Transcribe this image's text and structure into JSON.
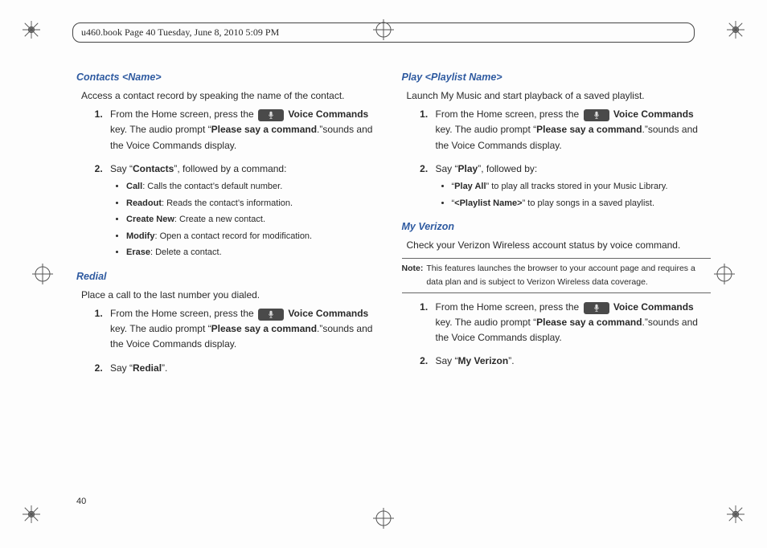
{
  "meta": {
    "header": "u460.book  Page 40  Tuesday, June 8, 2010  5:09 PM",
    "page_number": "40"
  },
  "contacts": {
    "heading": "Contacts <Name>",
    "intro": "Access a contact record by speaking the name of the contact.",
    "step1_pre": "From the Home screen, press the ",
    "step1_post1": " Voice Commands",
    "step1_post2": " key. The audio prompt “",
    "step1_bold": "Please say a command",
    "step1_tail": ".”sounds and the Voice Commands display.",
    "step2_a": "Say “",
    "step2_b": "Contacts",
    "step2_c": "”, followed by a command:",
    "bullets": {
      "b1a": "Call",
      "b1b": ": Calls the contact’s default number.",
      "b2a": "Readout",
      "b2b": ": Reads the contact’s information.",
      "b3a": "Create New",
      "b3b": ": Create a new contact.",
      "b4a": "Modify",
      "b4b": ": Open a contact record for modification.",
      "b5a": "Erase",
      "b5b": ": Delete a contact."
    }
  },
  "redial": {
    "heading": "Redial",
    "intro": "Place a call to the last number you dialed.",
    "step1_pre": "From the Home screen, press the ",
    "step1_post1": " Voice Commands",
    "step1_post2": " key. The audio prompt “",
    "step1_bold": "Please say a command",
    "step1_tail": ".”sounds and the Voice Commands display.",
    "step2_a": "Say “",
    "step2_b": "Redial",
    "step2_c": "”."
  },
  "play": {
    "heading": "Play <Playlist Name>",
    "intro": "Launch My Music and start playback of a saved playlist.",
    "step1_pre": "From the Home screen, press the ",
    "step1_post1": " Voice Commands",
    "step1_post2": " key. The audio prompt “",
    "step1_bold": "Please say a command",
    "step1_tail": ".”sounds and the Voice Commands display.",
    "step2_a": "Say “",
    "step2_b": "Play",
    "step2_c": "”, followed by:",
    "bullets": {
      "b1a": "“",
      "b1b": "Play All",
      "b1c": "” to play all tracks stored in your Music Library.",
      "b2a": "“",
      "b2b": "<Playlist Name>",
      "b2c": "” to play songs in a saved playlist."
    }
  },
  "verizon": {
    "heading": "My Verizon",
    "intro": "Check your Verizon Wireless account status by voice command.",
    "note_label": "Note:",
    "note_text": "This features launches the browser to your account page and requires a data plan and is subject to Verizon Wireless data coverage.",
    "step1_pre": "From the Home screen, press the ",
    "step1_post1": " Voice Commands",
    "step1_post2": " key. The audio prompt “",
    "step1_bold": "Please say a command",
    "step1_tail": ".”sounds and the Voice Commands display.",
    "step2_a": "Say “",
    "step2_b": "My Verizon",
    "step2_c": "”."
  }
}
